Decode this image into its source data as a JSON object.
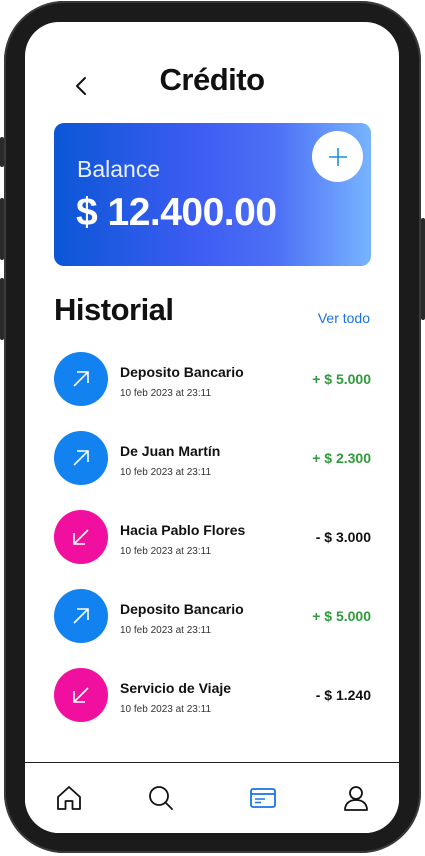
{
  "header": {
    "title": "Crédito"
  },
  "balance_card": {
    "label": "Balance",
    "amount": "$ 12.400.00"
  },
  "history": {
    "title": "Historial",
    "see_all": "Ver todo",
    "items": [
      {
        "name": "Deposito Bancario",
        "date": "10 feb 2023 at 23:11",
        "amount": "+ $ 5.000",
        "direction": "in"
      },
      {
        "name": "De Juan Martín",
        "date": "10 feb 2023 at 23:11",
        "amount": "+ $ 2.300",
        "direction": "in"
      },
      {
        "name": "Hacia Pablo Flores",
        "date": "10 feb 2023 at 23:11",
        "amount": "- $ 3.000",
        "direction": "out"
      },
      {
        "name": "Deposito Bancario",
        "date": "10 feb 2023 at 23:11",
        "amount": "+ $ 5.000",
        "direction": "in"
      },
      {
        "name": "Servicio de Viaje",
        "date": "10 feb 2023 at 23:11",
        "amount": "- $ 1.240",
        "direction": "out"
      }
    ]
  },
  "tab_bar": {
    "tabs": [
      {
        "icon": "home-icon",
        "active": false
      },
      {
        "icon": "search-icon",
        "active": false
      },
      {
        "icon": "card-icon",
        "active": true
      },
      {
        "icon": "profile-icon",
        "active": false
      }
    ]
  },
  "colors": {
    "accent": "#1a73e8",
    "incoming": "#1282f0",
    "outgoing": "#f10f9f",
    "positive_amount": "#2e9b3a",
    "card_gradient_start": "#0b57d6",
    "card_gradient_end": "#77b4ff"
  }
}
